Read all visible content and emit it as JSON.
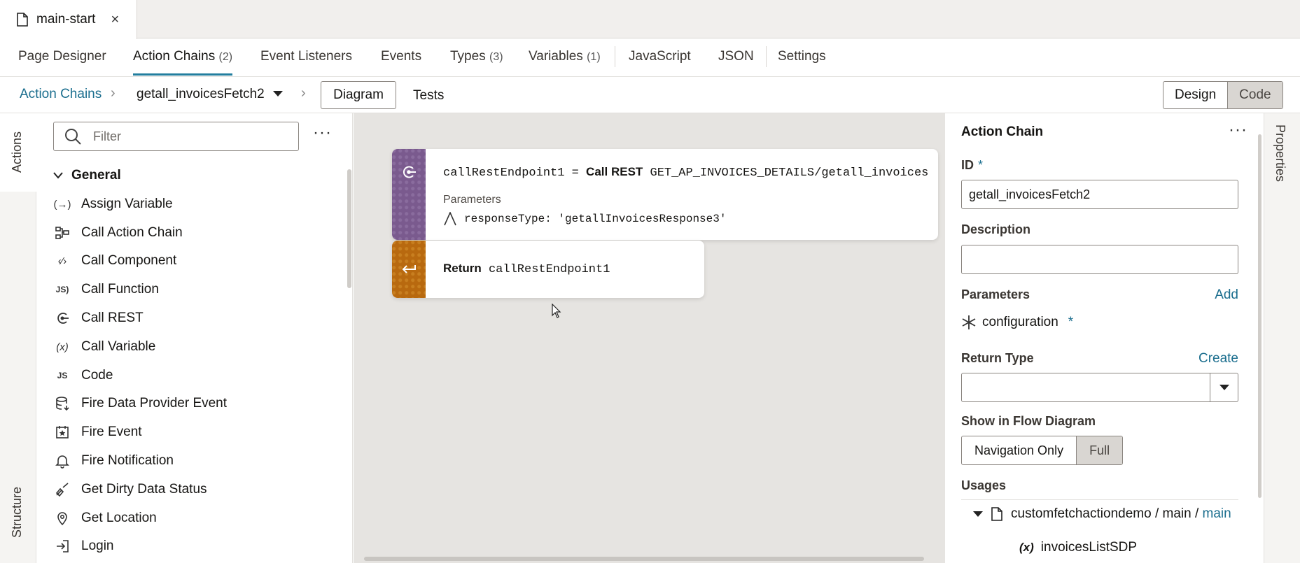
{
  "file_tab": {
    "name": "main-start",
    "close": "×"
  },
  "editor_tabs": [
    {
      "label": "Page Designer",
      "count": ""
    },
    {
      "label": "Action Chains",
      "count": "(2)"
    },
    {
      "label": "Event Listeners",
      "count": ""
    },
    {
      "label": "Events",
      "count": ""
    },
    {
      "label": "Types",
      "count": "(3)"
    },
    {
      "label": "Variables",
      "count": "(1)"
    },
    {
      "label": "JavaScript",
      "count": ""
    },
    {
      "label": "JSON",
      "count": ""
    },
    {
      "label": "Settings",
      "count": ""
    }
  ],
  "breadcrumb": {
    "root": "Action Chains",
    "current": "getall_invoicesFetch2",
    "diagram": "Diagram",
    "tests": "Tests"
  },
  "view_toggle": {
    "design": "Design",
    "code": "Code"
  },
  "left_rail": {
    "actions": "Actions",
    "structure": "Structure"
  },
  "actions_panel": {
    "filter_placeholder": "Filter",
    "group": "General",
    "items": [
      {
        "label": "Assign Variable",
        "icon": "assign-variable-icon"
      },
      {
        "label": "Call Action Chain",
        "icon": "call-action-chain-icon"
      },
      {
        "label": "Call Component",
        "icon": "call-component-icon"
      },
      {
        "label": "Call Function",
        "icon": "call-function-icon"
      },
      {
        "label": "Call REST",
        "icon": "call-rest-icon"
      },
      {
        "label": "Call Variable",
        "icon": "call-variable-icon"
      },
      {
        "label": "Code",
        "icon": "code-icon"
      },
      {
        "label": "Fire Data Provider Event",
        "icon": "data-provider-icon"
      },
      {
        "label": "Fire Event",
        "icon": "fire-event-icon"
      },
      {
        "label": "Fire Notification",
        "icon": "bell-icon"
      },
      {
        "label": "Get Dirty Data Status",
        "icon": "dirty-data-icon"
      },
      {
        "label": "Get Location",
        "icon": "location-pin-icon"
      },
      {
        "label": "Login",
        "icon": "login-icon"
      }
    ]
  },
  "diagram": {
    "node1": {
      "var": "callRestEndpoint1",
      "eq": "=",
      "kind": "Call REST",
      "endpoint": "GET_AP_INVOICES_DETAILS/getall_invoices",
      "params_label": "Parameters",
      "param": "responseType: 'getallInvoicesResponse3'"
    },
    "node2": {
      "kind": "Return",
      "value": "callRestEndpoint1"
    },
    "colors": {
      "call_rest": "#7a5a8e",
      "return": "#b8690f",
      "canvas": "#e6e4e1"
    }
  },
  "properties": {
    "title": "Action Chain",
    "id_label": "ID",
    "required_mark": "*",
    "id_value": "getall_invoicesFetch2",
    "description_label": "Description",
    "description_value": "",
    "parameters_label": "Parameters",
    "add_link": "Add",
    "param_name": "configuration",
    "return_type_label": "Return Type",
    "create_link": "Create",
    "return_type_value": "",
    "flow_label": "Show in Flow Diagram",
    "flow_nav": "Navigation Only",
    "flow_full": "Full",
    "usages_label": "Usages",
    "usage_path": "customfetchactiondemo / main /",
    "usage_link": "main",
    "usage_var": "invoicesListSDP",
    "rail_label": "Properties"
  },
  "accent": "#227e9e",
  "link_color": "#1b6e8e"
}
